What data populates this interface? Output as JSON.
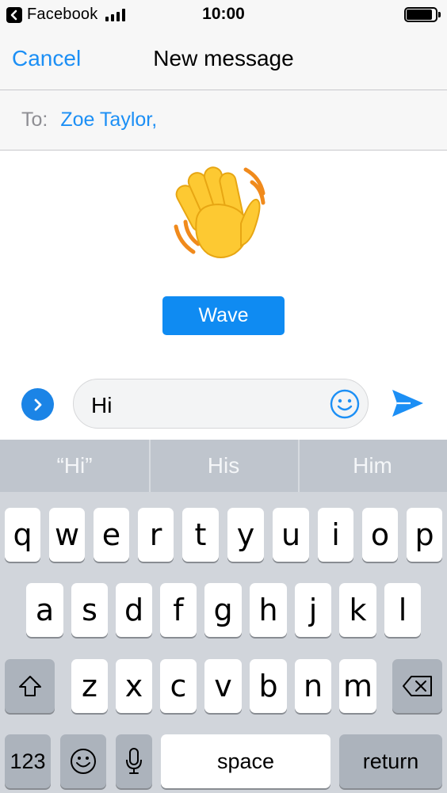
{
  "status_bar": {
    "back_app": "Facebook",
    "time": "10:00",
    "battery_level": 0.9
  },
  "nav": {
    "cancel_label": "Cancel",
    "title": "New message"
  },
  "recipient": {
    "label": "To:",
    "value": "Zoe Taylor,"
  },
  "wave": {
    "emoji_icon": "waving-hand-icon",
    "button_label": "Wave"
  },
  "composer": {
    "text": "Hi",
    "expand_icon": "chevron-right-icon",
    "emoji_icon": "smiley-icon",
    "send_icon": "send-arrow-icon"
  },
  "keyboard": {
    "suggestions": [
      "“Hi”",
      "His",
      "Him"
    ],
    "row1": [
      "q",
      "w",
      "e",
      "r",
      "t",
      "y",
      "u",
      "i",
      "o",
      "p"
    ],
    "row2": [
      "a",
      "s",
      "d",
      "f",
      "g",
      "h",
      "j",
      "k",
      "l"
    ],
    "row3": [
      "z",
      "x",
      "c",
      "v",
      "b",
      "n",
      "m"
    ],
    "shift_icon": "shift-icon",
    "delete_icon": "backspace-icon",
    "numbers_label": "123",
    "emoji_key_icon": "emoji-icon",
    "dictation_icon": "microphone-icon",
    "space_label": "space",
    "return_label": "return"
  },
  "colors": {
    "accent": "#1c8ff5",
    "wave_button": "#0f8bf2",
    "keyboard_bg": "#d1d5db",
    "suggestion_bar": "#bfc5cd"
  }
}
